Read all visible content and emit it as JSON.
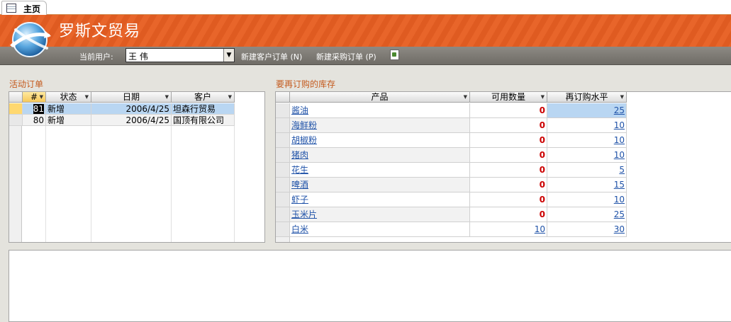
{
  "tab": {
    "label": "主页"
  },
  "banner": {
    "title": "罗斯文贸易"
  },
  "toolbar": {
    "user_label": "当前用户:",
    "user_value": "王 伟",
    "new_customer_order": "新建客户订单 (N)",
    "new_purchase_order": "新建采购订单 (P)"
  },
  "active_orders": {
    "title": "活动订单",
    "columns": [
      "#",
      "状态",
      "日期",
      "客户"
    ],
    "rows": [
      {
        "id": "81",
        "status": "新增",
        "date": "2006/4/25",
        "customer": "坦森行贸易"
      },
      {
        "id": "80",
        "status": "新增",
        "date": "2006/4/25",
        "customer": "国顶有限公司"
      }
    ]
  },
  "reorder": {
    "title": "要再订购的库存",
    "columns": [
      "产品",
      "可用数量",
      "再订购水平"
    ],
    "rows": [
      {
        "product": "酱油",
        "available": "0",
        "level": "25"
      },
      {
        "product": "海鲜粉",
        "available": "0",
        "level": "10"
      },
      {
        "product": "胡椒粉",
        "available": "0",
        "level": "10"
      },
      {
        "product": "猪肉",
        "available": "0",
        "level": "10"
      },
      {
        "product": "花生",
        "available": "0",
        "level": "5"
      },
      {
        "product": "啤酒",
        "available": "0",
        "level": "15"
      },
      {
        "product": "虾子",
        "available": "0",
        "level": "10"
      },
      {
        "product": "玉米片",
        "available": "0",
        "level": "25"
      },
      {
        "product": "白米",
        "available": "10",
        "level": "30"
      }
    ]
  },
  "colors": {
    "accent": "#e8652a",
    "section_title": "#c45a1d",
    "link": "#1f52a8",
    "zero": "#cc0000"
  }
}
